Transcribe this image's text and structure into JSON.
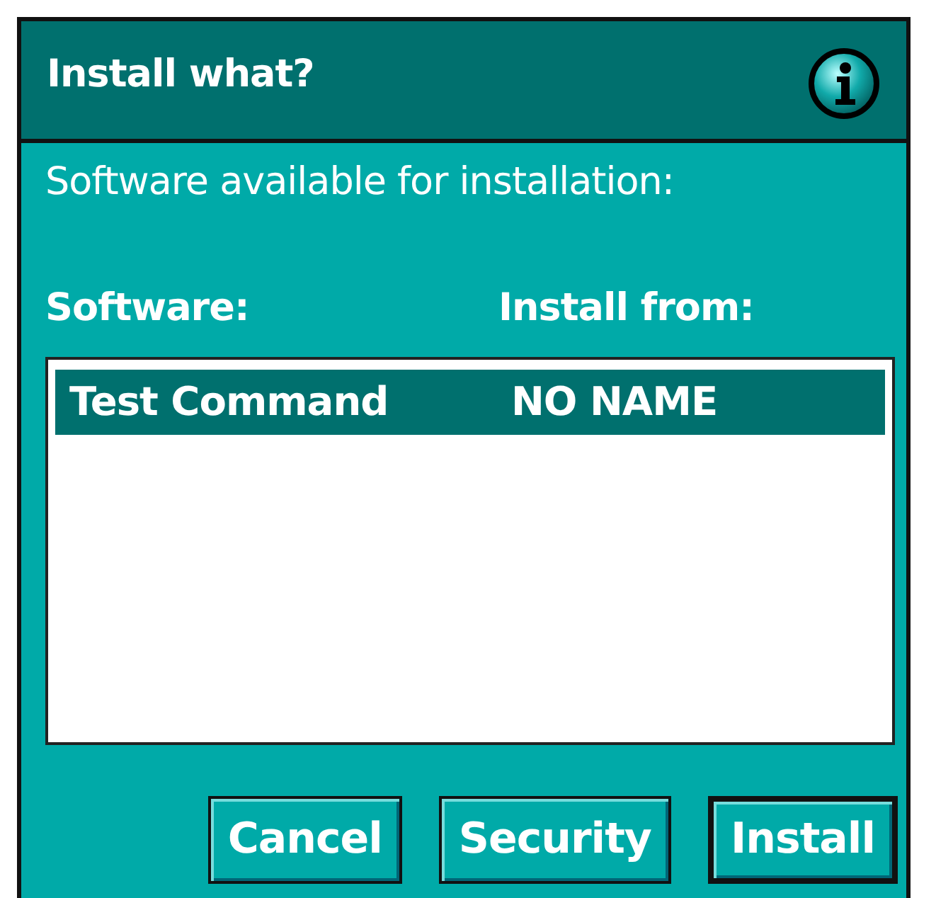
{
  "window": {
    "title": "Install what?"
  },
  "prompt": "Software available for installation:",
  "columns": [
    "Software:",
    "Install from:"
  ],
  "rows": [
    {
      "software": "Test Command",
      "source": "NO NAME",
      "selected": true
    }
  ],
  "buttons": [
    {
      "label": "Cancel",
      "default": false
    },
    {
      "label": "Security",
      "default": false
    },
    {
      "label": "Install",
      "default": true
    }
  ]
}
